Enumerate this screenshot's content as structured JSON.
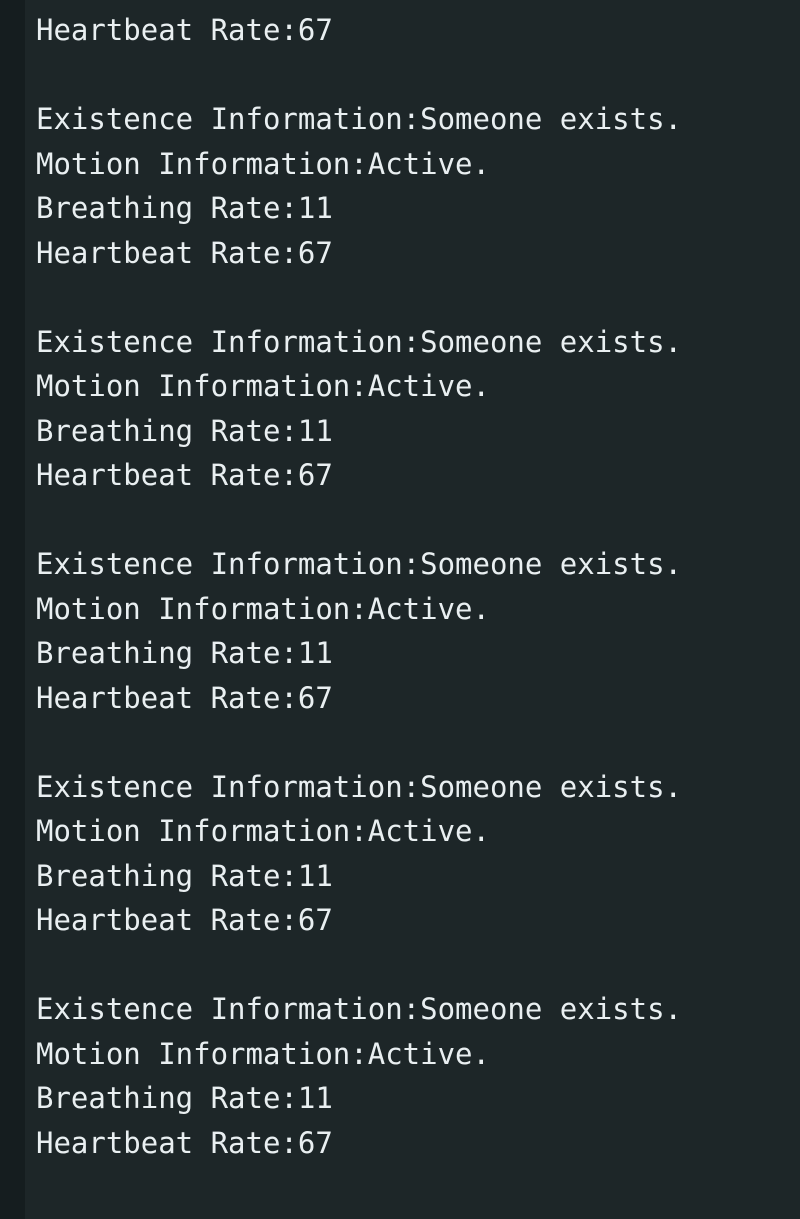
{
  "window": {
    "kind": "terminal-log-output",
    "background_color": "#1d2628",
    "gutter_color": "#151d1f",
    "text_color": "#e9eff1"
  },
  "log": {
    "labels": {
      "existence": "Existence Information",
      "motion": "Motion Information",
      "breathing": "Breathing Rate",
      "heartbeat": "Heartbeat Rate"
    },
    "values": {
      "existence": "Someone exists.",
      "motion": "Active.",
      "breathing": "11",
      "heartbeat": "67"
    },
    "blank_line": "",
    "partial_first_line": "Heartbeat Rate:67",
    "blocks": [
      {
        "lines": [
          "Existence Information:Someone exists.",
          "Motion Information:Active.",
          "Breathing Rate:11",
          "Heartbeat Rate:67"
        ]
      },
      {
        "lines": [
          "Existence Information:Someone exists.",
          "Motion Information:Active.",
          "Breathing Rate:11",
          "Heartbeat Rate:67"
        ]
      },
      {
        "lines": [
          "Existence Information:Someone exists.",
          "Motion Information:Active.",
          "Breathing Rate:11",
          "Heartbeat Rate:67"
        ]
      },
      {
        "lines": [
          "Existence Information:Someone exists.",
          "Motion Information:Active.",
          "Breathing Rate:11",
          "Heartbeat Rate:67"
        ]
      },
      {
        "lines": [
          "Existence Information:Someone exists.",
          "Motion Information:Active.",
          "Breathing Rate:11",
          "Heartbeat Rate:67"
        ]
      }
    ]
  }
}
